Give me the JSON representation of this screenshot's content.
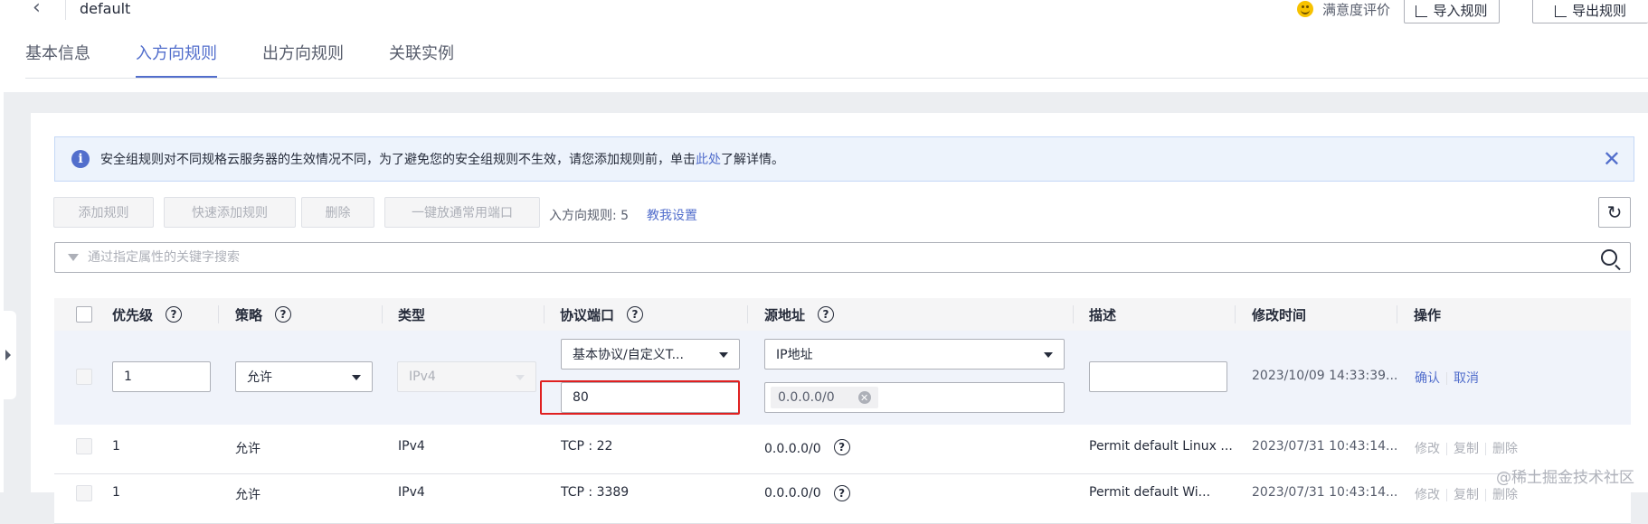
{
  "header": {
    "title": "default",
    "satisfaction": "满意度评价",
    "import_btn": "导入规则",
    "export_btn": "导出规则"
  },
  "tabs": [
    "基本信息",
    "入方向规则",
    "出方向规则",
    "关联实例"
  ],
  "active_tab": "入方向规则",
  "notice": {
    "text_before": "安全组规则对不同规格云服务器的生效情况不同，为了避免您的安全组规则不生效，请您添加规则前，单击",
    "link": "此处",
    "text_after": "了解详情。"
  },
  "toolbar": {
    "add": "添加规则",
    "quick_add": "快速添加规则",
    "delete": "删除",
    "open_ports": "一键放通常用端口",
    "count_label": "入方向规则: 5",
    "teach": "教我设置"
  },
  "search": {
    "placeholder": "通过指定属性的关键字搜索"
  },
  "table": {
    "headers": [
      "优先级",
      "策略",
      "类型",
      "协议端口",
      "源地址",
      "描述",
      "修改时间",
      "操作"
    ]
  },
  "edit_row": {
    "priority": "1",
    "policy": "允许",
    "type": "IPv4",
    "protocol": "基本协议/自定义T...",
    "port": "80",
    "source_type": "IP地址",
    "source_tag": "0.0.0.0/0",
    "description": "",
    "modified": "2023/10/09 14:33:39...",
    "confirm": "确认",
    "cancel": "取消"
  },
  "rows": [
    {
      "priority": "1",
      "policy": "允许",
      "type": "IPv4",
      "port": "TCP : 22",
      "source": "0.0.0.0/0",
      "description": "Permit default Linux ...",
      "modified": "2023/07/31 10:43:14...",
      "ops": [
        "修改",
        "复制",
        "删除"
      ]
    },
    {
      "priority": "1",
      "policy": "允许",
      "type": "IPv4",
      "port": "TCP : 3389",
      "source": "0.0.0.0/0",
      "description": "Permit default Wi...",
      "modified": "2023/07/31 10:43:14...",
      "ops": [
        "修改",
        "复制",
        "删除"
      ]
    }
  ],
  "watermark": "@稀土掘金技术社区",
  "colors": {
    "accent": "#526ecc",
    "highlight": "#e02020",
    "edit_row_bg": "#f0f3fa"
  }
}
